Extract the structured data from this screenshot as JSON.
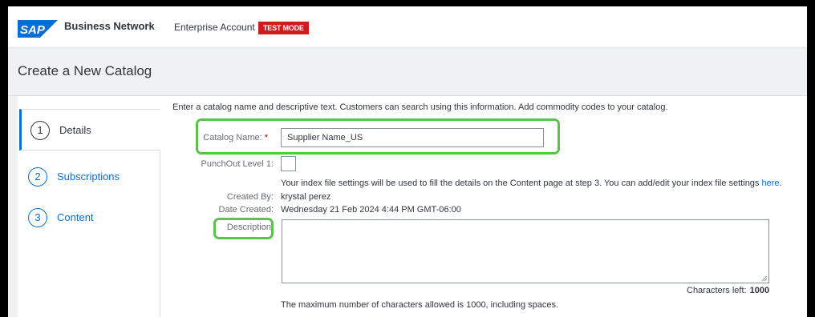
{
  "header": {
    "logo_text": "SAP",
    "brand": "Business Network",
    "account": "Enterprise Account",
    "test_badge": "TEST MODE",
    "brand_color": "#0a6ed1",
    "badge_color": "#cf1b1b"
  },
  "page": {
    "title": "Create a New Catalog"
  },
  "steps": [
    {
      "number": "1",
      "label": "Details",
      "active": true
    },
    {
      "number": "2",
      "label": "Subscriptions",
      "active": false
    },
    {
      "number": "3",
      "label": "Content",
      "active": false
    }
  ],
  "form": {
    "intro": "Enter a catalog name and descriptive text. Customers can search using this information. Add commodity codes to your catalog.",
    "catalog_name_label": "Catalog Name:",
    "required_mark": "*",
    "catalog_name_value": "Supplier Name_US",
    "punchout_label": "PunchOut Level 1:",
    "punchout_checked": false,
    "index_note": "Your index file settings will be used to fill the details on the Content page at step 3. You can add/edit your index file settings",
    "index_link": "here",
    "index_period": ".",
    "created_by_label": "Created By:",
    "created_by_value": "krystal perez",
    "date_created_label": "Date Created:",
    "date_created_value": "Wednesday 21 Feb 2024 4:44 PM GMT-06:00",
    "description_label": "Description:",
    "description_value": "",
    "chars_left_label": "Characters left:",
    "chars_left_value": "1000",
    "max_note": "The maximum number of characters allowed is 1000, including spaces."
  },
  "highlight_color": "#5cc24a"
}
